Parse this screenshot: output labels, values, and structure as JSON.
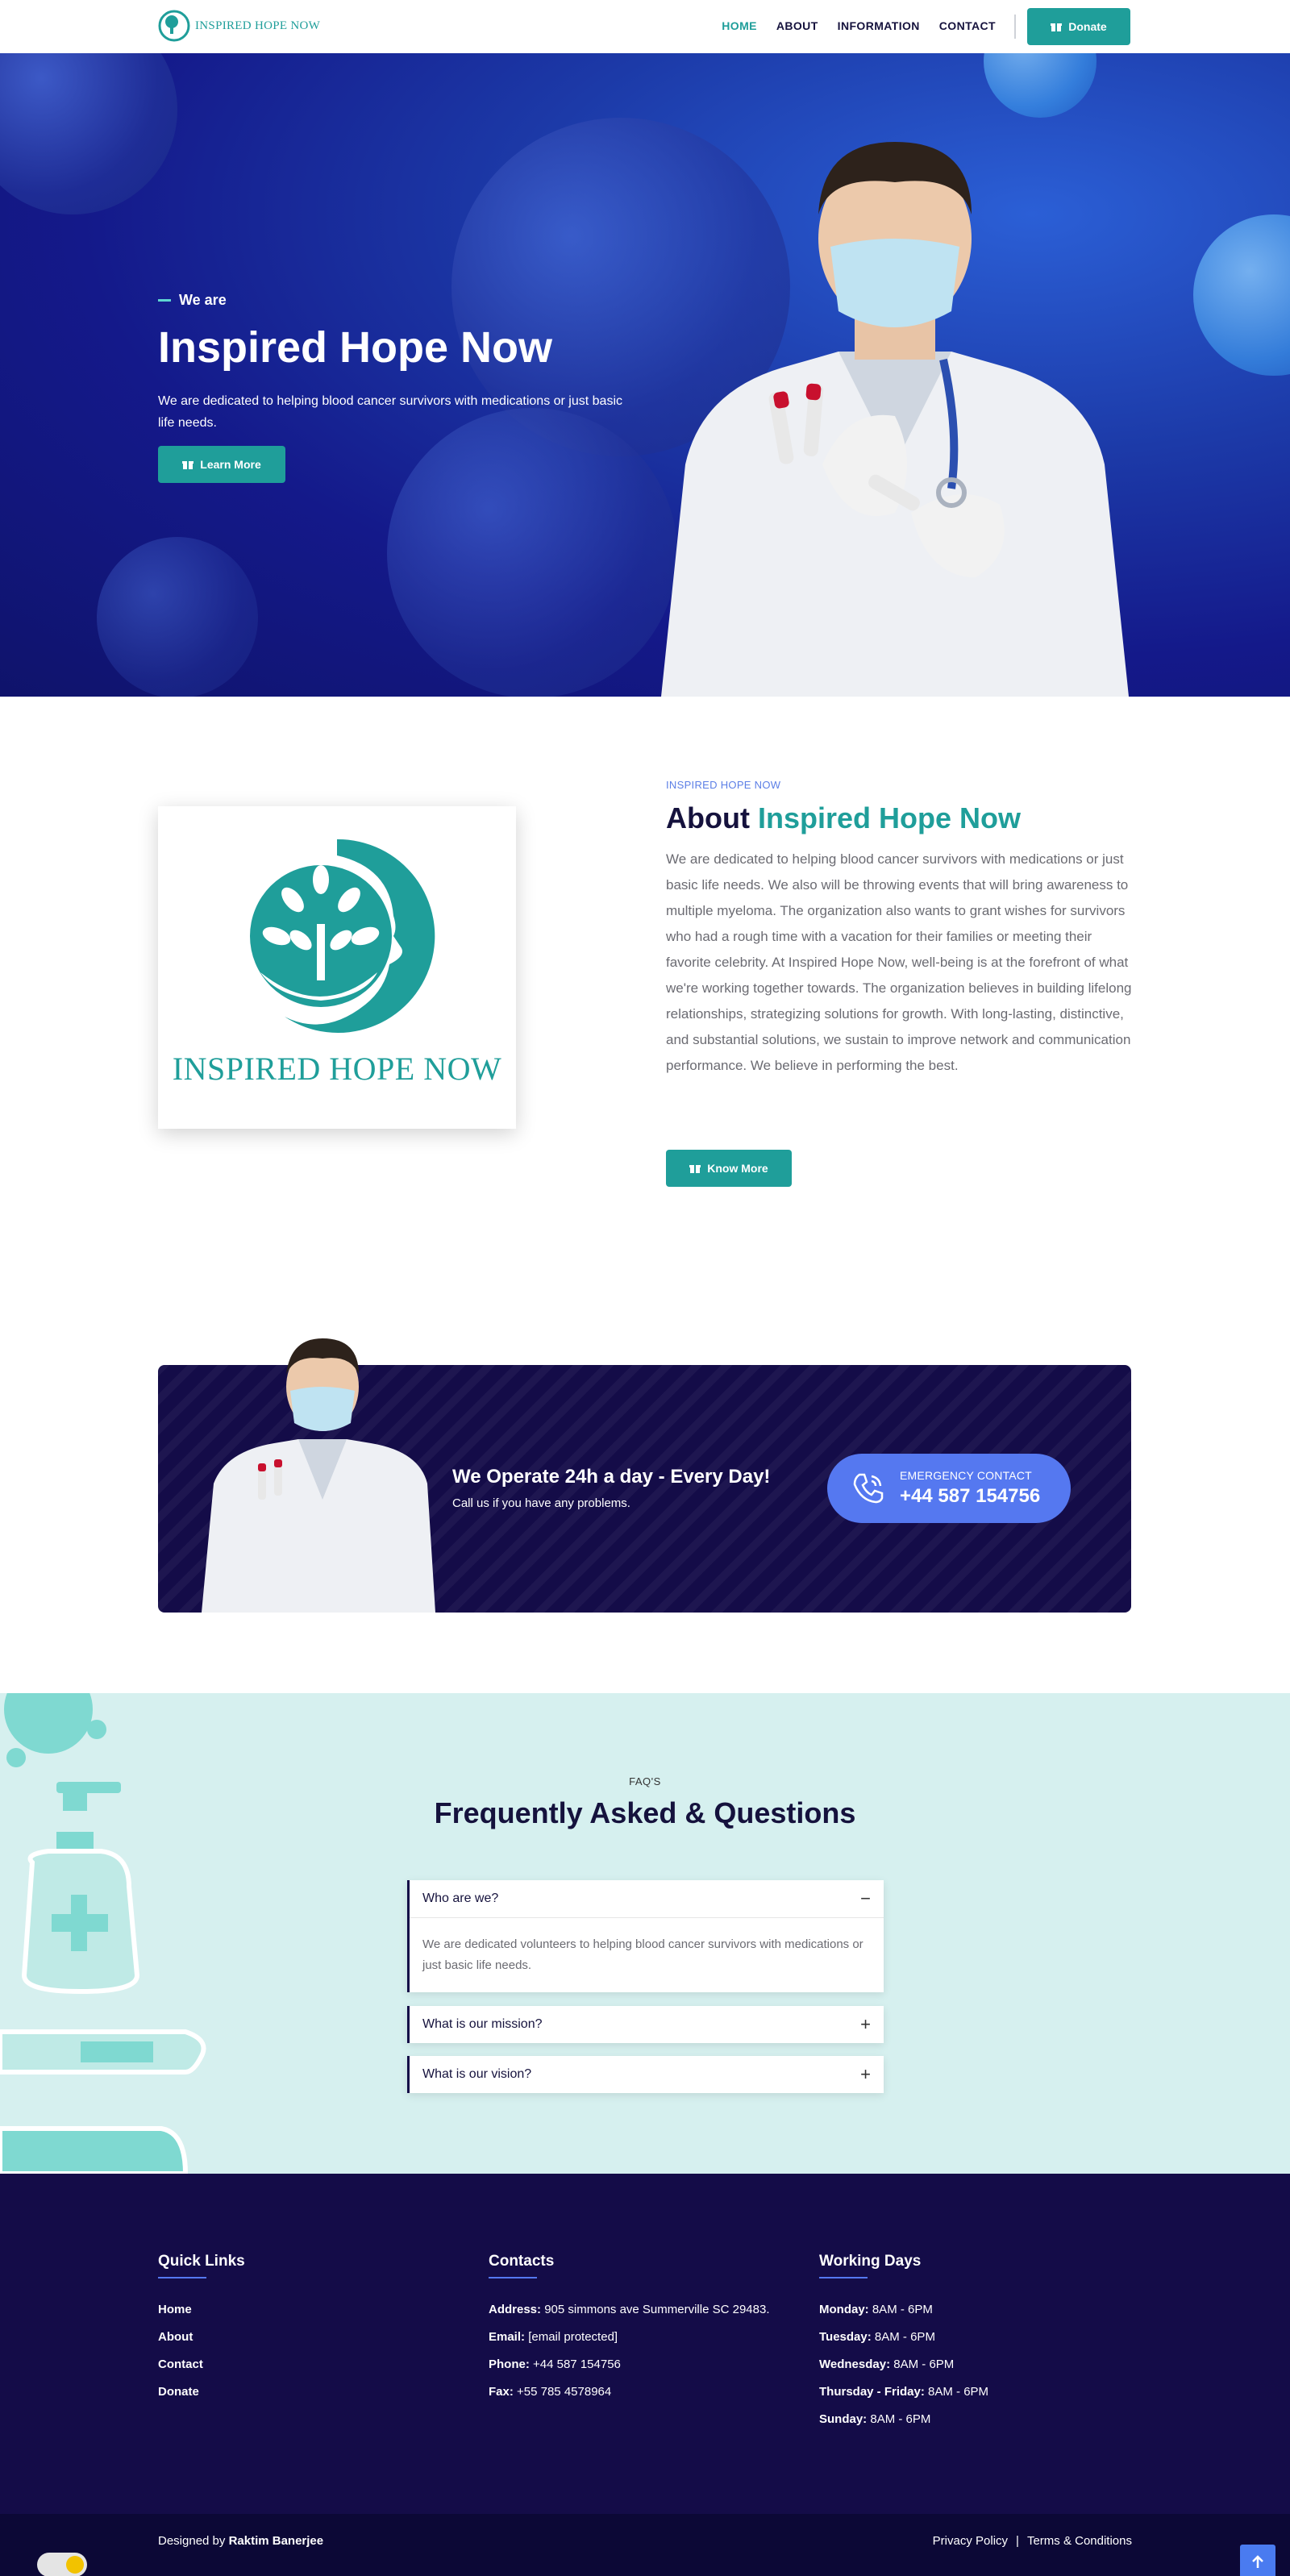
{
  "nav": {
    "brand": "INSPIRED HOPE NOW",
    "links": [
      "HOME",
      "ABOUT",
      "INFORMATION",
      "CONTACT"
    ],
    "donate_label": "Donate",
    "accent": "#1f9e9a"
  },
  "hero": {
    "eyebrow": "We are",
    "title": "Inspired Hope Now",
    "text": "We are dedicated to helping blood cancer survivors with medications or just basic life needs.",
    "cta": "Learn More"
  },
  "about": {
    "logo_text": "INSPIRED HOPE NOW",
    "eyebrow": "INSPIRED HOPE NOW",
    "title_prefix": "About",
    "title_highlight": "Inspired Hope Now",
    "body": "We are dedicated to helping blood cancer survivors with medications or just basic life needs. We also will be throwing events that will bring awareness to multiple myeloma. The organization also wants to grant wishes for survivors who had a rough time with a vacation for their families or meeting their favorite celebrity. At Inspired Hope Now, well-being is at the forefront of what we're working together towards. The organization believes in building lifelong relationships, strategizing solutions for growth. With long-lasting, distinctive, and substantial solutions, we sustain to improve network and communication performance. We believe in performing the best.",
    "cta": "Know More"
  },
  "banner": {
    "title": "We Operate 24h a day - Every Day!",
    "subtitle": "Call us if you have any problems.",
    "contact_label": "EMERGENCY CONTACT",
    "phone": "+44 587 154756"
  },
  "faq": {
    "eyebrow": "FAQ'S",
    "title": "Frequently Asked & Questions",
    "items": [
      {
        "q": "Who are we?",
        "a": "We are dedicated volunteers to helping blood cancer survivors with medications or just basic life needs.",
        "open": true
      },
      {
        "q": "What is our mission?",
        "open": false
      },
      {
        "q": "What is our vision?",
        "open": false
      }
    ]
  },
  "footer": {
    "quick_links": {
      "title": "Quick Links",
      "items": [
        "Home",
        "About",
        "Contact",
        "Donate"
      ]
    },
    "contacts": {
      "title": "Contacts",
      "items": [
        {
          "label": "Address:",
          "value": "905 simmons ave Summerville SC 29483."
        },
        {
          "label": "Email:",
          "value": "[email protected]"
        },
        {
          "label": "Phone:",
          "value": "+44 587 154756"
        },
        {
          "label": "Fax:",
          "value": "+55 785 4578964"
        }
      ]
    },
    "working_days": {
      "title": "Working Days",
      "items": [
        {
          "label": "Monday:",
          "value": "8AM - 6PM"
        },
        {
          "label": "Tuesday:",
          "value": "8AM - 6PM"
        },
        {
          "label": "Wednesday:",
          "value": "8AM - 6PM"
        },
        {
          "label": "Thursday - Friday:",
          "value": "8AM - 6PM"
        },
        {
          "label": "Sunday:",
          "value": "8AM - 6PM"
        }
      ]
    },
    "credit_prefix": "Designed by",
    "credit_name": "Raktim Banerjee",
    "privacy": "Privacy Policy",
    "separator": "|",
    "terms": "Terms & Conditions"
  }
}
